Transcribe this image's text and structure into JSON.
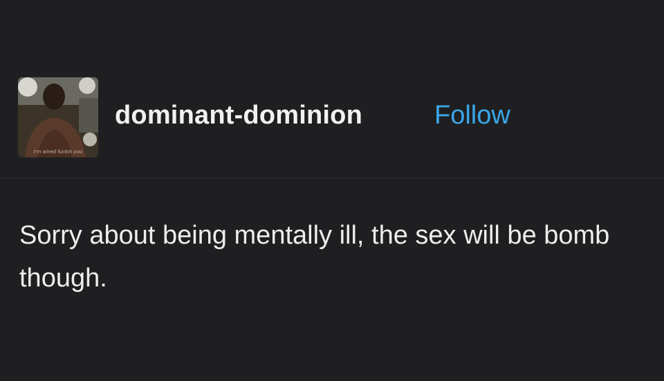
{
  "post": {
    "avatar": {
      "icon": "avatar-image",
      "caption": "I'm wired fuckin you"
    },
    "username": "dominant-dominion",
    "follow_label": "Follow",
    "text": "Sorry about being mentally ill, the sex will be bomb though."
  },
  "colors": {
    "background": "#1f1f21",
    "text": "#ededed",
    "follow_accent": "#3aa7e8"
  }
}
